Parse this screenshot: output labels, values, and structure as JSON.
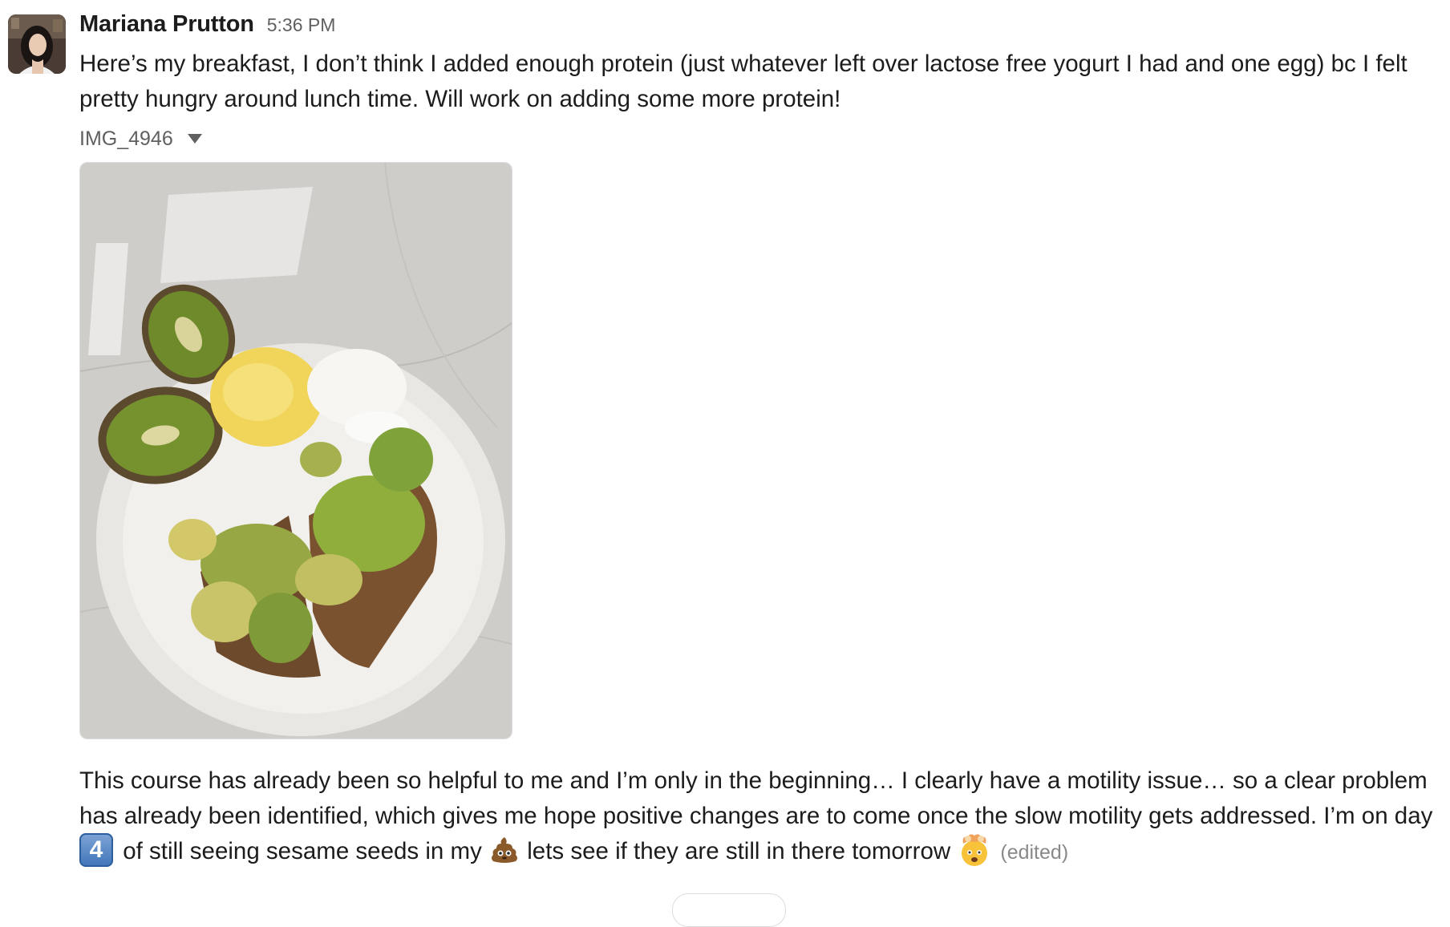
{
  "message": {
    "sender": "Mariana Prutton",
    "timestamp": "5:36 PM",
    "text": "Here’s my breakfast, I don’t think I added enough protein (just whatever left over lactose free yogurt I had and one egg) bc I felt pretty hungry around lunch time. Will work on adding some more protein!",
    "attachment": {
      "filename": "IMG_4946",
      "icon": "caret-down-icon"
    },
    "followup": {
      "text_part1": "This course has already been so helpful to me and I’m only in the beginning… I clearly have a motility issue… so a clear problem has already been identified, which gives me hope positive changes are to come once the slow motility gets addressed. I’m on day",
      "keycap": "4",
      "text_part2": "of still seeing sesame seeds in my",
      "text_part3": "lets see if they are still in there tomorrow",
      "edited": "(edited)",
      "emojis": [
        "keycap-4-emoji",
        "poop-emoji",
        "exploding-head-emoji"
      ]
    }
  },
  "colors": {
    "text": "#1d1c1d",
    "muted": "#616061",
    "edited": "#8a898a",
    "border": "#dddddd"
  }
}
